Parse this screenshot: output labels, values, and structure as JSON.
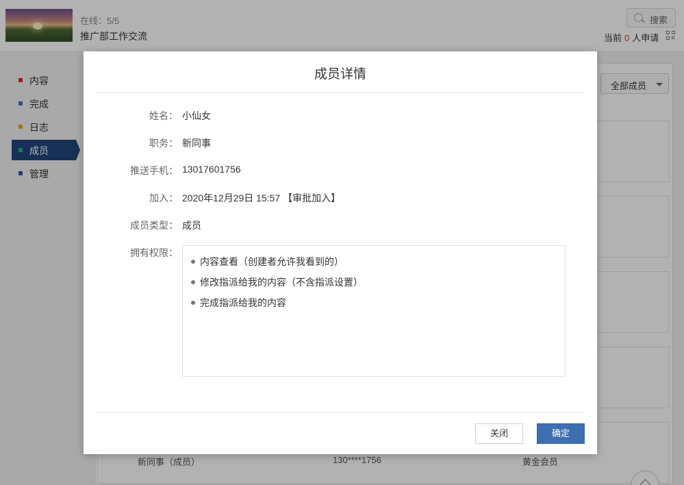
{
  "header": {
    "online_label": "在线：5/5",
    "group_name": "推广部工作交流",
    "search_label": "搜索",
    "apply_prefix": "当前",
    "apply_count": "0",
    "apply_suffix": "人申请"
  },
  "sidebar": {
    "items": [
      {
        "label": "内容",
        "color": "#d9302a"
      },
      {
        "label": "完成",
        "color": "#3e6fd1"
      },
      {
        "label": "日志",
        "color": "#e8a21a"
      },
      {
        "label": "成员",
        "color": "#1fb57a",
        "active": true
      },
      {
        "label": "管理",
        "color": "#3450b8"
      }
    ]
  },
  "filter": {
    "selected": "全部成员"
  },
  "background_row": {
    "role": "新同事（成员）",
    "phone": "130****1756",
    "level": "黄金会员"
  },
  "modal": {
    "title": "成员详情",
    "fields": {
      "name": {
        "label": "姓名：",
        "value": "小仙女"
      },
      "position": {
        "label": "职务：",
        "value": "新同事"
      },
      "phone": {
        "label": "推送手机：",
        "value": "13017601756"
      },
      "joined": {
        "label": "加入：",
        "value": "2020年12月29日 15:57 【审批加入】"
      },
      "member_type": {
        "label": "成员类型：",
        "value": "成员"
      },
      "permissions": {
        "label": "拥有权限："
      }
    },
    "permissions": [
      "内容查看（创建者允许我看到的）",
      "修改指派给我的内容（不含指派设置）",
      "完成指派给我的内容"
    ],
    "close_label": "关闭",
    "ok_label": "确定"
  },
  "colors": {
    "accent": "#3e6fb0",
    "active_nav": "#21457c",
    "apply_count": "#d9302a"
  }
}
